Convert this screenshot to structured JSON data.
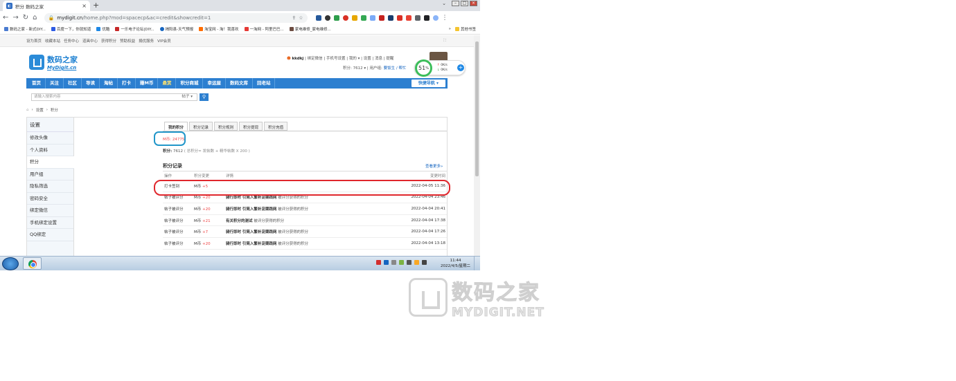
{
  "browser": {
    "tab_title": "积分 数码之家",
    "url_host": "mydigit.cn",
    "url_path": "/home.php?mod=spacecp&ac=credit&showcredit=1",
    "bookmarks": [
      "数码之家 - 新式DIY...",
      "百度一下，你就知道",
      "优酷",
      "一乐电子论坛|DIY...",
      "揭阳县-天气预报",
      "淘宝网 - 淘！我喜欢",
      "一淘网 - 阿里巴巴...",
      "家电维修_家电维修..."
    ],
    "other_bookmarks": "其他书签"
  },
  "site": {
    "topbar_links": [
      "设为首页",
      "收藏本站",
      "任务中心",
      "道具中心",
      "获得积分",
      "赞助权益",
      "捐优服务",
      "VIP会员"
    ],
    "logo_cn": "数码之家",
    "logo_en": "MyDigit.cn",
    "user": {
      "name": "kkdkj",
      "links": "| 绑定微信 | 手机号设置 | 我的 ▾ | 设置 | 消息 | 提醒",
      "credit_line": "积分: 7612 ▾",
      "group_label": "用户组:",
      "group_value": "要饭生 / 帮忙"
    },
    "nav": [
      "首页",
      "关注",
      "社区",
      "导读",
      "淘帖",
      "打卡",
      "赚M币",
      "悬赏",
      "积分商城",
      "幸运屋",
      "数码文库",
      "回老站"
    ],
    "nav_hot_index": 7,
    "quick_nav": "快捷导航 ▾",
    "search_placeholder": "请输入搜索内容",
    "search_type": "帖子 ▾",
    "search_icon": "search-icon",
    "breadcrumb": [
      "设置",
      "积分"
    ]
  },
  "net_widget": {
    "percent": "51",
    "unit": "%",
    "up": "0K/s",
    "down": "0K/s"
  },
  "sidebar": {
    "title": "设置",
    "items": [
      "修改头像",
      "个人资料",
      "积分",
      "用户组",
      "隐私筛选",
      "密码安全",
      "绑定微信",
      "手机绑定设置",
      "QQ绑定"
    ],
    "active_index": 2
  },
  "credit": {
    "tabs": [
      "我的积分",
      "积分记录",
      "积分规则",
      "积分提现",
      "积分充值"
    ],
    "mcoin_label": "M币:",
    "mcoin_value": "24775",
    "points_label": "积分:",
    "points_value": "7612",
    "points_formula": "( 总积分= 发帖数 + 精华帖数 X 200 )",
    "records_title": "积分记录",
    "see_more": "查看更多»",
    "columns": [
      "操作",
      "积分变更",
      "详情",
      "变更时间"
    ],
    "rows": [
      {
        "op": "打卡签到",
        "unit": "M币",
        "amt": "+5",
        "title": "",
        "detail": "",
        "time": "2022-04-05 11:36"
      },
      {
        "op": "帖子被评分",
        "unit": "M币",
        "amt": "+20",
        "title": "骑行即时 引简入繁补淀渠践网",
        "detail": "被评分获得的积分",
        "time": "2022-04-04 23:46"
      },
      {
        "op": "帖子被评分",
        "unit": "M币",
        "amt": "+20",
        "title": "骑行即时 引简入繁补淀渠践网",
        "detail": "被评分获得的积分",
        "time": "2022-04-04 20:41"
      },
      {
        "op": "帖子被评分",
        "unit": "M币",
        "amt": "+21",
        "title": "有关积分的测试",
        "detail": "被评分获得的积分",
        "time": "2022-04-04 17:38"
      },
      {
        "op": "帖子被评分",
        "unit": "M币",
        "amt": "+7",
        "title": "骑行即时 引简入繁补淀渠践网",
        "detail": "被评分获得的积分",
        "time": "2022-04-04 17:26"
      },
      {
        "op": "帖子被评分",
        "unit": "M币",
        "amt": "+20",
        "title": "骑行即时 引简入繁补淀渠践网",
        "detail": "被评分获得的积分",
        "time": "2022-04-04 13:18"
      }
    ]
  },
  "taskbar": {
    "time": "11:44",
    "date": "2022/4/5/星期二"
  },
  "watermark": {
    "cn": "数码之家",
    "en": "MYDIGIT.NET"
  },
  "colors": {
    "nav_blue": "#2c7fd0",
    "highlight_red": "#e0262c",
    "highlight_blue": "#2196c9",
    "amount_red": "#e44444"
  }
}
